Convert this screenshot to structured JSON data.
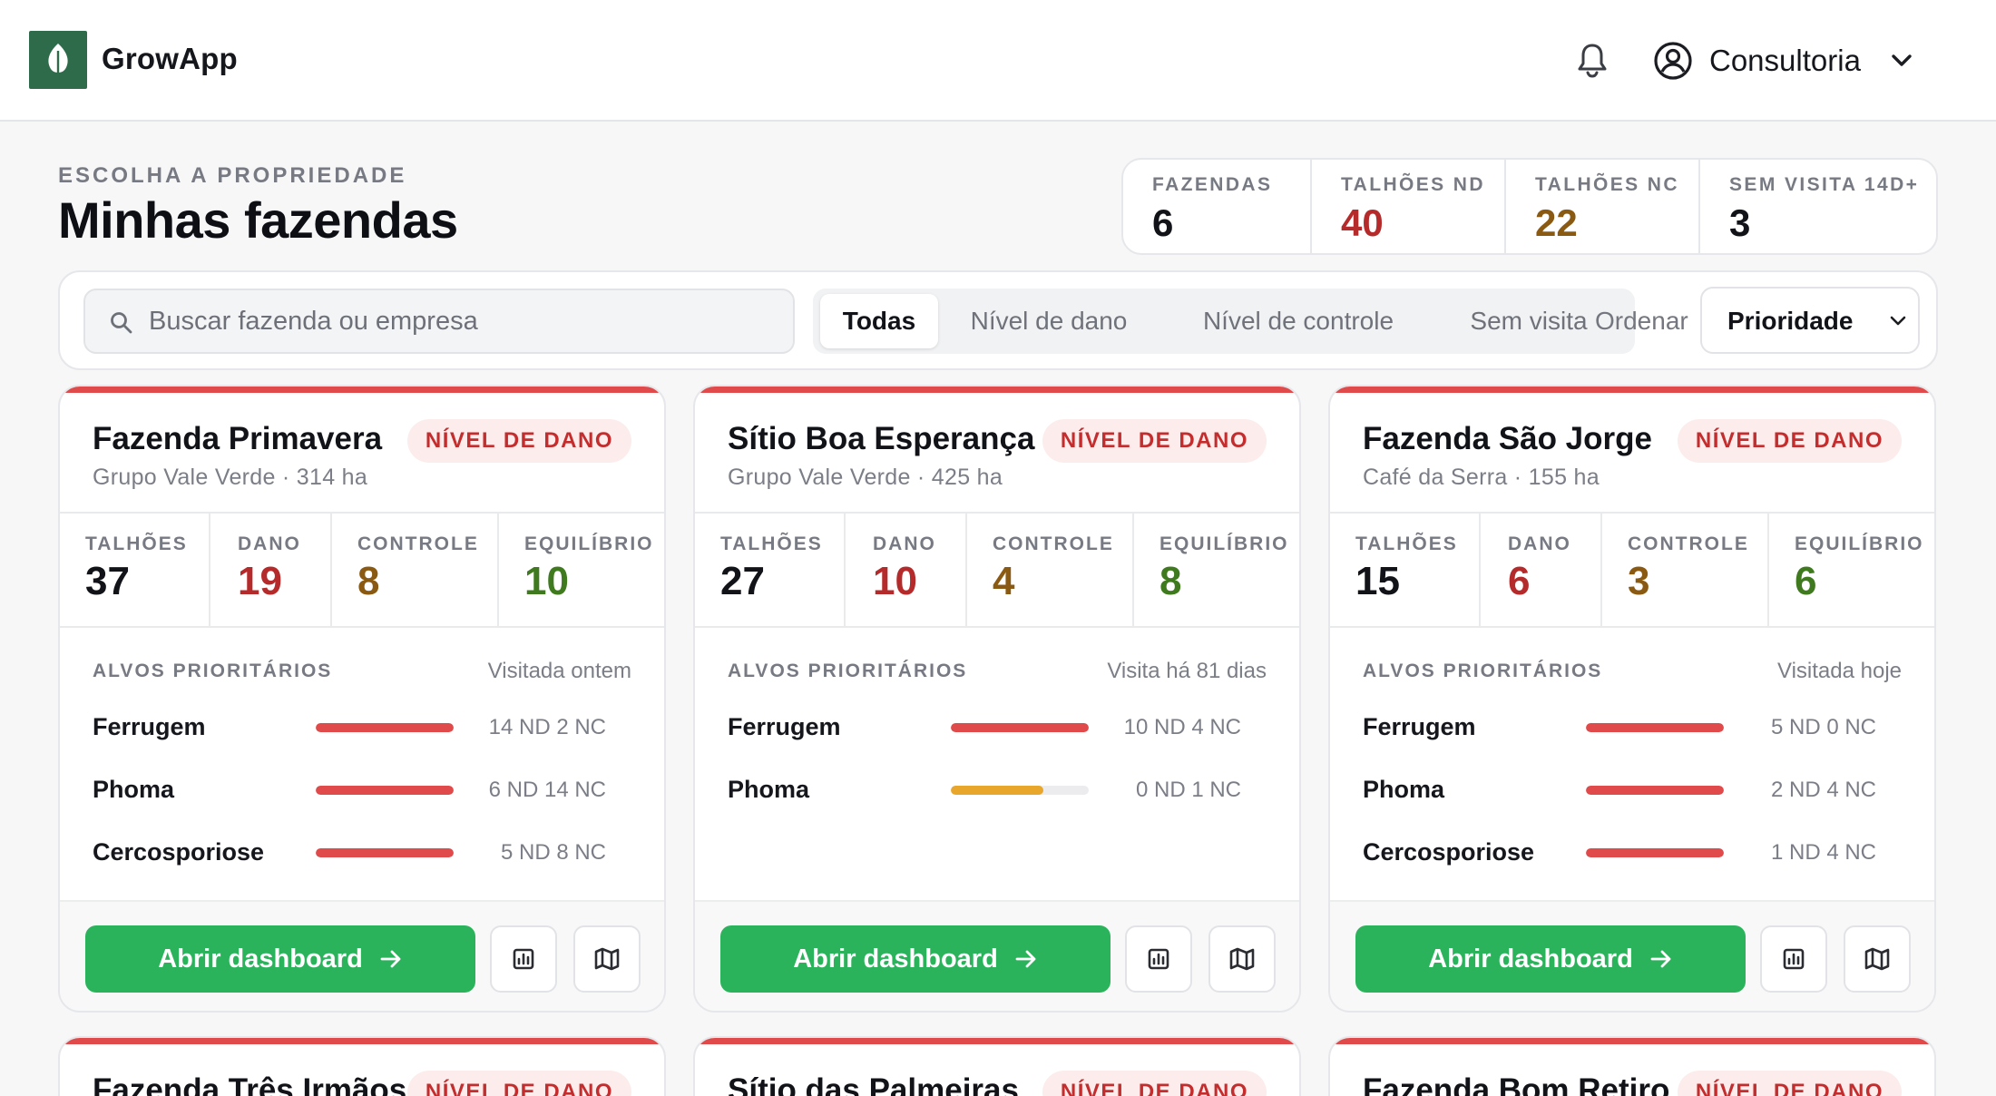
{
  "app": {
    "name": "GrowApp",
    "user": "Consultoria"
  },
  "page": {
    "eyebrow": "ESCOLHA A PROPRIEDADE",
    "title": "Minhas fazendas"
  },
  "summary": [
    {
      "label": "FAZENDAS",
      "value": "6",
      "color": "#111318"
    },
    {
      "label": "TALHÕES ND",
      "value": "40",
      "color": "#b52a2a"
    },
    {
      "label": "TALHÕES NC",
      "value": "22",
      "color": "#8a5a12"
    },
    {
      "label": "SEM VISITA 14D+",
      "value": "3",
      "color": "#111318"
    }
  ],
  "filters": {
    "search_placeholder": "Buscar fazenda ou empresa",
    "tabs": [
      "Todas",
      "Nível de dano",
      "Nível de controle",
      "Sem visita"
    ],
    "active_tab": "Todas",
    "sort_label": "Ordenar",
    "sort_value": "Prioridade"
  },
  "colors": {
    "damage": "#e04a4a",
    "control": "#e8a62a",
    "primary": "#2bb35c",
    "brand": "#2e6b4a"
  },
  "metric_labels": [
    "TALHÕES",
    "DANO",
    "CONTROLE",
    "EQUILÍBRIO"
  ],
  "labels": {
    "targets": "ALVOS PRIORITÁRIOS",
    "open": "Abrir dashboard"
  },
  "farms": [
    {
      "name": "Fazenda Primavera",
      "sub": "Grupo Vale Verde · 314 ha",
      "badge": "NÍVEL DE DANO",
      "metrics": [
        "37",
        "19",
        "8",
        "10"
      ],
      "visit": "Visitada ontem",
      "targets": [
        {
          "name": "Ferrugem",
          "count": "14 ND 2 NC",
          "level": 1.0,
          "status": "damage"
        },
        {
          "name": "Phoma",
          "count": "6 ND 14 NC",
          "level": 1.0,
          "status": "damage"
        },
        {
          "name": "Cercosporiose",
          "count": "5 ND 8 NC",
          "level": 1.0,
          "status": "damage"
        }
      ]
    },
    {
      "name": "Sítio Boa Esperança",
      "sub": "Grupo Vale Verde · 425 ha",
      "badge": "NÍVEL DE DANO",
      "metrics": [
        "27",
        "10",
        "4",
        "8"
      ],
      "visit": "Visita há 81 dias",
      "targets": [
        {
          "name": "Ferrugem",
          "count": "10 ND 4 NC",
          "level": 1.0,
          "status": "damage"
        },
        {
          "name": "Phoma",
          "count": "0 ND 1 NC",
          "level": 0.67,
          "status": "control"
        }
      ]
    },
    {
      "name": "Fazenda São Jorge",
      "sub": "Café da Serra · 155 ha",
      "badge": "NÍVEL DE DANO",
      "metrics": [
        "15",
        "6",
        "3",
        "6"
      ],
      "visit": "Visitada hoje",
      "targets": [
        {
          "name": "Ferrugem",
          "count": "5 ND 0 NC",
          "level": 1.0,
          "status": "damage"
        },
        {
          "name": "Phoma",
          "count": "2 ND 4 NC",
          "level": 1.0,
          "status": "damage"
        },
        {
          "name": "Cercosporiose",
          "count": "1 ND 4 NC",
          "level": 1.0,
          "status": "damage"
        }
      ]
    },
    {
      "name": "Fazenda Três Irmãos",
      "badge": "NÍVEL DE DANO"
    },
    {
      "name": "Sítio das Palmeiras",
      "badge": "NÍVEL DE DANO"
    },
    {
      "name": "Fazenda Bom Retiro",
      "badge": "NÍVEL DE DANO"
    }
  ]
}
